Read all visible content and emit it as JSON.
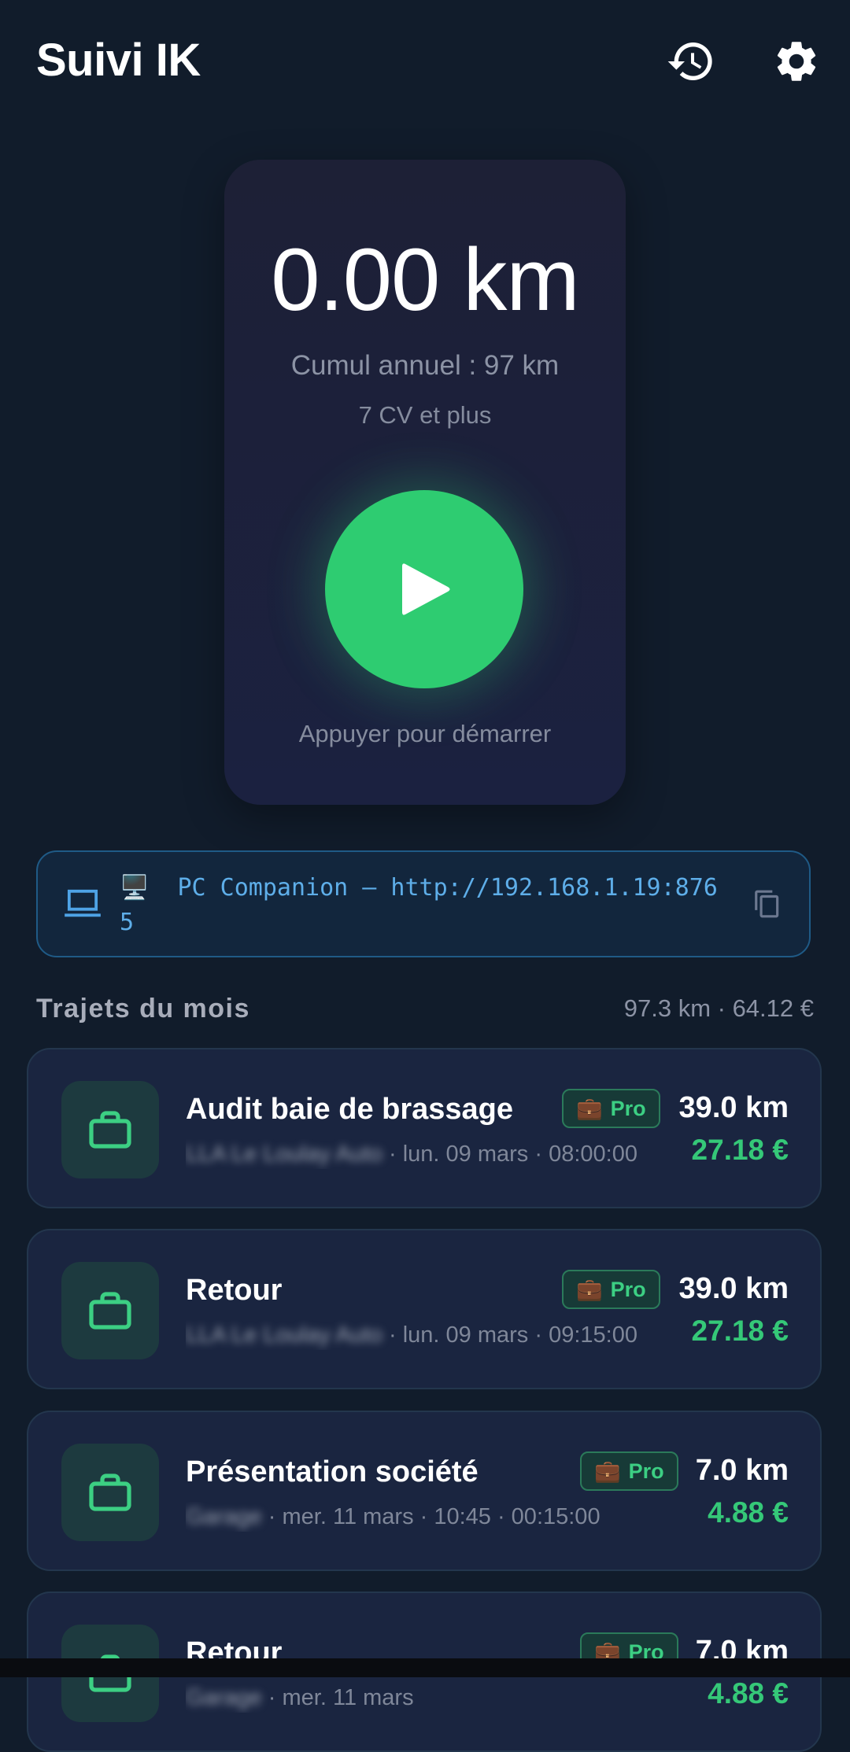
{
  "header": {
    "title": "Suivi IK",
    "history_icon": "history-icon",
    "settings_icon": "gear-icon"
  },
  "tracker": {
    "distance": "0.00 km",
    "annual_total": "Cumul annuel : 97 km",
    "vehicle_class": "7 CV et plus",
    "start_hint": "Appuyer pour démarrer",
    "play_icon": "play-icon"
  },
  "companion": {
    "text": "🖥️  PC Companion — http://192.168.1.19:8765",
    "laptop_icon": "laptop-icon",
    "copy_icon": "copy-icon"
  },
  "trips_section": {
    "title": "Trajets du mois",
    "summary": "97.3 km · 64.12 €"
  },
  "trips": [
    {
      "title": "Audit baie de brassage",
      "location": "LLA Le Loulay Auto",
      "details": " · lun. 09 mars · 08:00:00",
      "badge": "Pro",
      "distance": "39.0 km",
      "amount": "27.18 €"
    },
    {
      "title": "Retour",
      "location": "LLA Le Loulay Auto",
      "details": " · lun. 09 mars · 09:15:00",
      "badge": "Pro",
      "distance": "39.0 km",
      "amount": "27.18 €"
    },
    {
      "title": "Présentation société",
      "location": "Garage",
      "details": " · mer. 11 mars · 10:45 · 00:15:00",
      "badge": "Pro",
      "distance": "7.0 km",
      "amount": "4.88 €"
    },
    {
      "title": "Retour",
      "location": "Garage",
      "details": " · mer. 11 mars",
      "badge": "Pro",
      "distance": "7.0 km",
      "amount": "4.88 €"
    }
  ],
  "colors": {
    "background": "#111c2b",
    "accent_green": "#2ecc71",
    "companion_blue": "#5eaee9"
  }
}
